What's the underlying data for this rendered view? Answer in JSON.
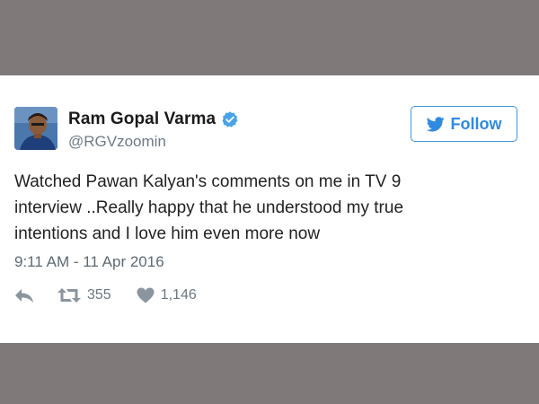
{
  "tweet": {
    "author_name": "Ram Gopal Varma",
    "handle": "@RGVzoomin",
    "follow_label": "Follow",
    "text_lines": [
      "Watched Pawan Kalyan's comments on me in TV 9",
      "interview ..Really happy that he understood my true",
      "intentions and I love him even more now"
    ],
    "timestamp": "9:11 AM - 11 Apr 2016",
    "retweets": "355",
    "likes": "1,146"
  },
  "colors": {
    "background_band": "#7f7979",
    "card": "#ffffff",
    "accent": "#2f8ae0",
    "muted": "#8a959e"
  },
  "icons": [
    "verified-badge-icon",
    "twitter-bird-icon",
    "reply-icon",
    "retweet-icon",
    "like-heart-icon"
  ]
}
